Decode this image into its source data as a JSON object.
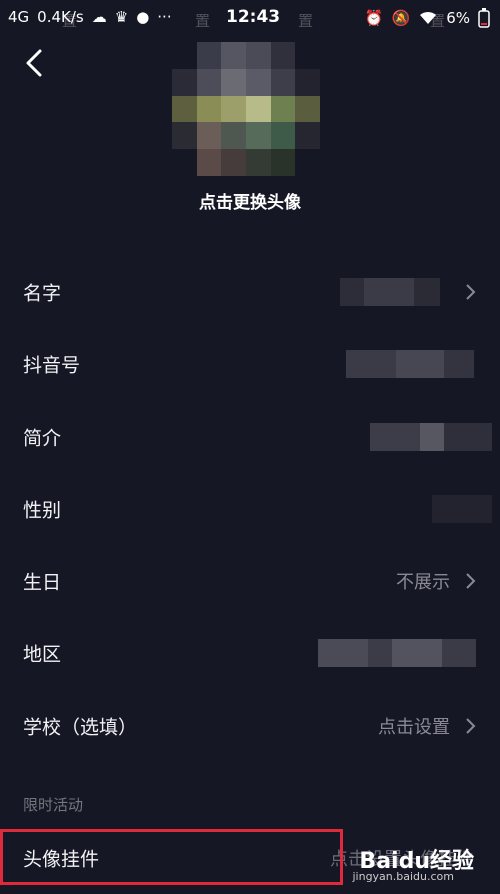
{
  "status_bar": {
    "network": "4G",
    "speed": "0.4K/s",
    "time": "12:43",
    "battery": "6%"
  },
  "watermark": {
    "text": "置"
  },
  "header": {
    "change_avatar_label": "点击更换头像"
  },
  "rows": [
    {
      "label": "名字",
      "value": ""
    },
    {
      "label": "抖音号",
      "value": ""
    },
    {
      "label": "简介",
      "value": ""
    },
    {
      "label": "性别",
      "value": ""
    },
    {
      "label": "生日",
      "value": "不展示"
    },
    {
      "label": "地区",
      "value": ""
    },
    {
      "label": "学校（选填）",
      "value": "点击设置"
    }
  ],
  "section": {
    "title": "限时活动"
  },
  "activity_row": {
    "label": "头像挂件",
    "value": "点击设置头像挂件"
  },
  "brand": {
    "logo_text": "Baidu经验",
    "site": "jingyan.baidu.com"
  },
  "colors": {
    "background": "#161724",
    "highlight": "#e0293b",
    "muted_text": "#8a8a96"
  },
  "icons": [
    "back-icon",
    "chevron-right-icon",
    "wifi-icon",
    "battery-icon",
    "alarm-icon"
  ]
}
